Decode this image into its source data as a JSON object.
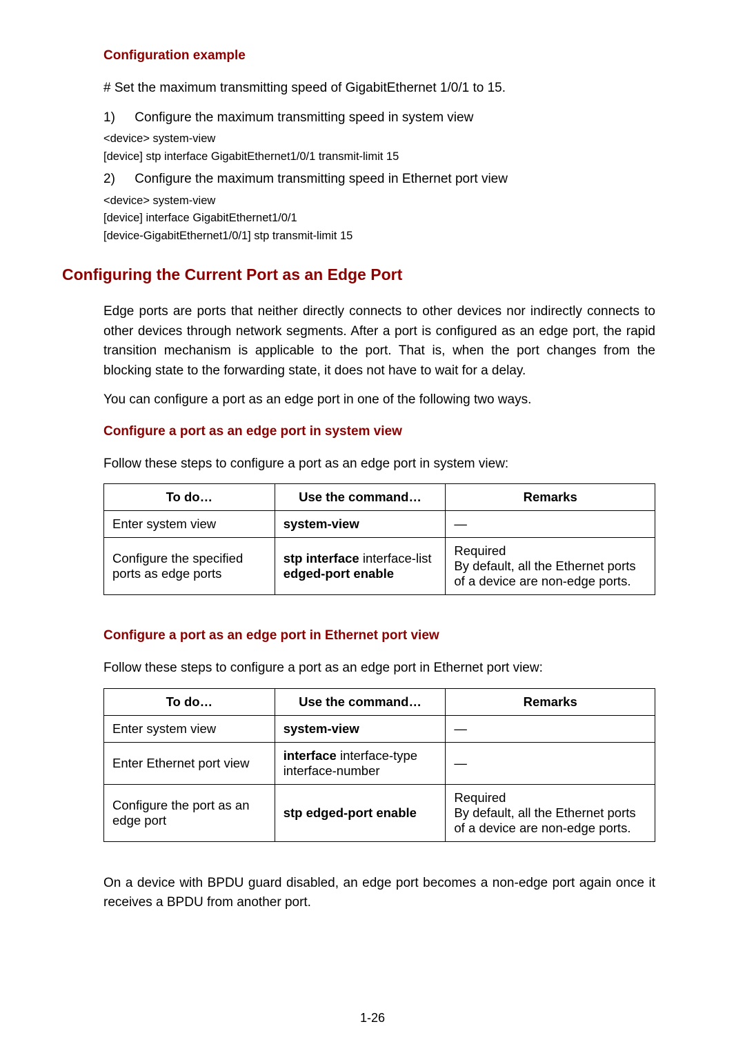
{
  "headings": {
    "config_example": "Configuration example",
    "edge_port_section": "Configuring the Current Port as an Edge Port",
    "cfg_system_view": "Configure a port as an edge port in system view",
    "cfg_eth_view": "Configure a port as an edge port in Ethernet port view"
  },
  "example": {
    "intro": "# Set the maximum transmitting speed of GigabitEthernet 1/0/1 to 15.",
    "step1_num": "1)",
    "step1_text": "Configure the maximum transmitting speed in system view",
    "step1_code1": "<device> system-view",
    "step1_code2": "[device] stp interface GigabitEthernet1/0/1 transmit-limit 15",
    "step2_num": "2)",
    "step2_text": "Configure the maximum transmitting speed in Ethernet port view",
    "step2_code1": "<device> system-view",
    "step2_code2": "[device] interface GigabitEthernet1/0/1",
    "step2_code3": "[device-GigabitEthernet1/0/1] stp transmit-limit 15"
  },
  "edge_intro1": "Edge ports are ports that neither directly connects to other devices nor indirectly connects to other devices through network segments. After a port is configured as an edge port, the rapid transition mechanism is applicable to the port. That is, when the port changes from the blocking state to the forwarding state, it does not have to wait for a delay.",
  "edge_intro2": "You can configure a port as an edge port in one of the following two ways.",
  "sysview_intro": "Follow these steps to configure a port as an edge port in system view:",
  "ethview_intro": "Follow these steps to configure a port as an edge port in Ethernet port view:",
  "table_headers": {
    "todo": "To do…",
    "cmd": "Use the command…",
    "remarks": "Remarks"
  },
  "table1": {
    "r1c1": "Enter system view",
    "r1c2": "system-view",
    "r1c3": "—",
    "r2c1": "Configure the specified ports as edge ports",
    "r2c2_b": "stp interface",
    "r2c2_n": " interface-list ",
    "r2c2_b2": "edged-port enable",
    "r2c3a": "Required",
    "r2c3b": "By default, all the Ethernet ports of a device are non-edge ports."
  },
  "table2": {
    "r1c1": "Enter system view",
    "r1c2": "system-view",
    "r1c3": "—",
    "r2c1": "Enter Ethernet port view",
    "r2c2_b": "interface",
    "r2c2_n": " interface-type interface-number",
    "r2c3": "—",
    "r3c1": "Configure the port as an edge port",
    "r3c2": "stp edged-port enable",
    "r3c3a": "Required",
    "r3c3b": "By default, all the Ethernet ports of a device are non-edge ports."
  },
  "note": "On a device with BPDU guard disabled, an edge port becomes a non-edge port again once it receives a BPDU from another port.",
  "page_number": "1-26"
}
